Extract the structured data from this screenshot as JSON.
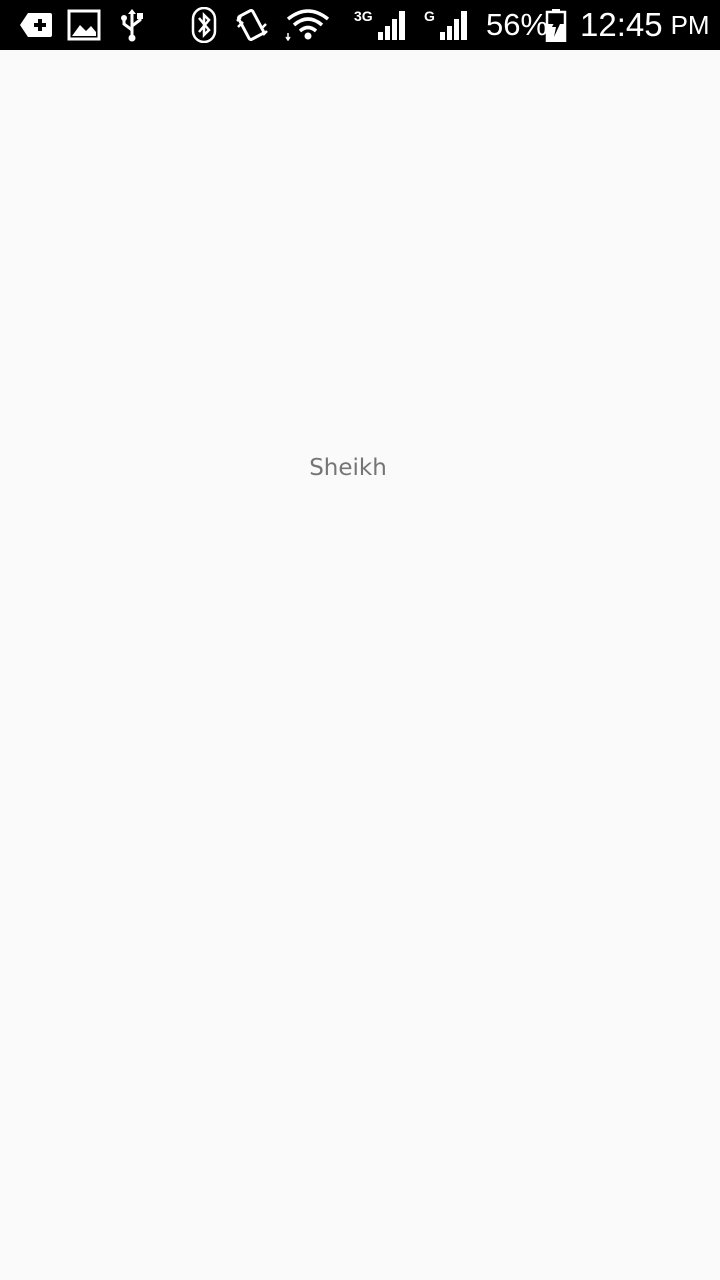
{
  "status_bar": {
    "icons": [
      "notification-add-icon",
      "image-notification-icon",
      "usb-icon",
      "bluetooth-icon",
      "vibrate-icon",
      "wifi-icon",
      "signal-3g-icon",
      "signal-g-icon",
      "battery-charging-icon"
    ],
    "sim1_network": "3G",
    "sim2_network": "G",
    "battery_percent": "56%",
    "time": "12:45",
    "ampm": "PM",
    "background_color": "#000000"
  },
  "main": {
    "label": "Sheikh",
    "background_color": "#fafafa",
    "text_color": "#757575"
  }
}
